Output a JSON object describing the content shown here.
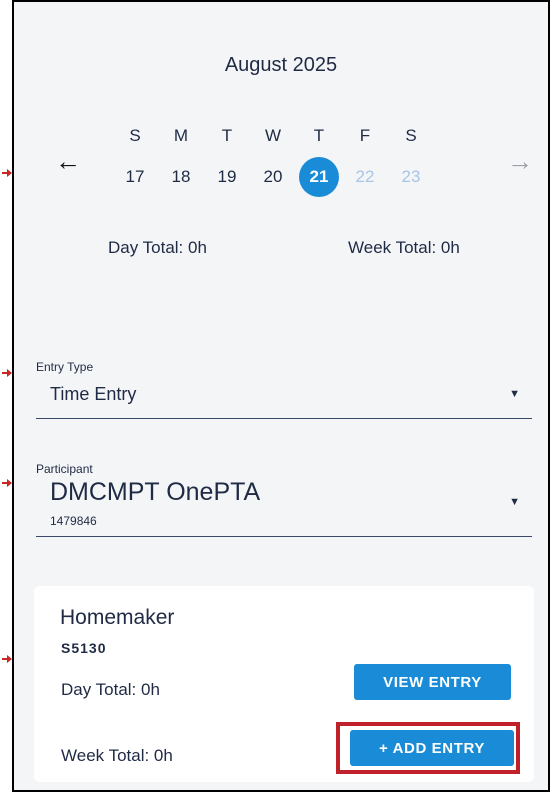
{
  "calendar": {
    "month_title": "August 2025",
    "prev_arrow": "←",
    "next_arrow": "→",
    "weekdays": [
      "S",
      "M",
      "T",
      "W",
      "T",
      "F",
      "S"
    ],
    "dates": [
      "17",
      "18",
      "19",
      "20",
      "21",
      "22",
      "23"
    ],
    "selected_date": "21",
    "day_total": "Day Total: 0h",
    "week_total": "Week Total: 0h"
  },
  "entry_type": {
    "label": "Entry Type",
    "value": "Time Entry",
    "caret": "▼"
  },
  "participant": {
    "label": "Participant",
    "value": "DMCMPT OnePTA",
    "id": "1479846",
    "caret": "▼"
  },
  "service_card": {
    "name": "Homemaker",
    "code": "S5130",
    "day_total": "Day Total: 0h",
    "week_total": "Week Total: 0h",
    "view_entry_label": "VIEW ENTRY",
    "add_entry_label": "+ ADD ENTRY"
  },
  "colors": {
    "accent": "#1a8bd6",
    "highlight": "#c0202a",
    "future_date": "#a9c4e6"
  }
}
